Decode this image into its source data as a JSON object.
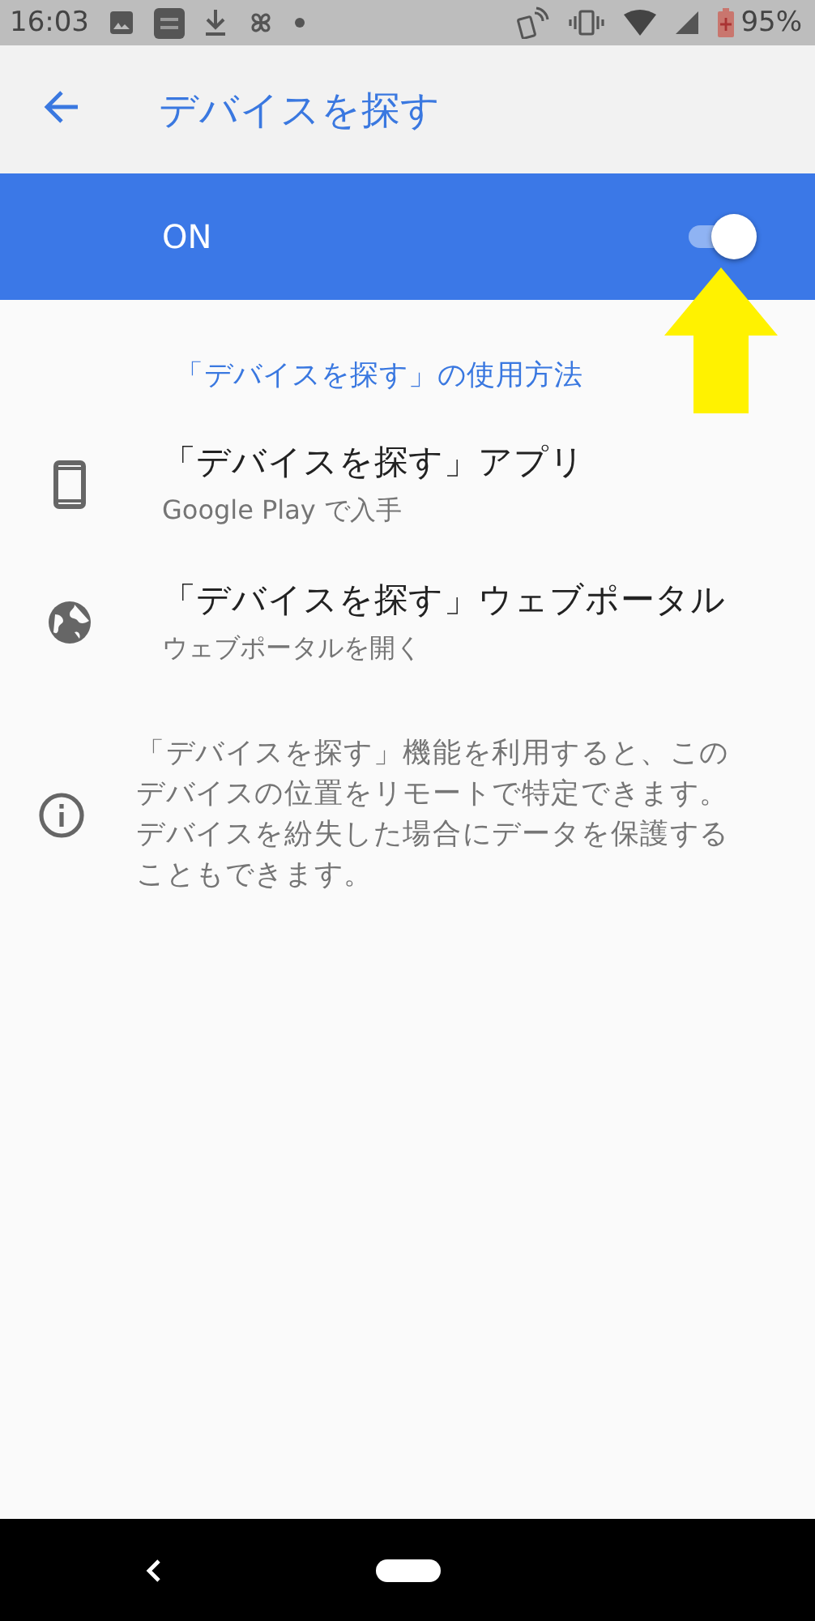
{
  "status_bar": {
    "time": "16:03",
    "battery": "95%"
  },
  "header": {
    "title": "デバイスを探す"
  },
  "master_switch": {
    "label": "ON",
    "on": true
  },
  "help_link": "「デバイスを探す」の使用方法",
  "items": [
    {
      "kind": "phone",
      "title": "「デバイスを探す」アプリ",
      "subtitle": "Google Play で入手"
    },
    {
      "kind": "globe",
      "title": "「デバイスを探す」ウェブポータル",
      "subtitle": "ウェブポータルを開く"
    }
  ],
  "info": {
    "text": "「デバイスを探す」機能を利用すると、このデバイスの位置をリモートで特定できます。デバイスを紛失した場合にデータを保護することもできます。"
  }
}
